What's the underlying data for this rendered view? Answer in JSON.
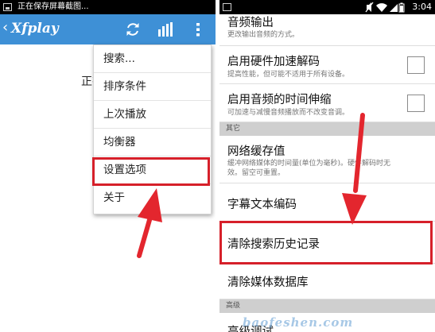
{
  "left_screen": {
    "status_text": "正在保存屏幕截图...",
    "app_title": "Xfplay",
    "background_text": "正在",
    "menu": [
      {
        "label": "搜索..."
      },
      {
        "label": "排序条件"
      },
      {
        "label": "上次播放"
      },
      {
        "label": "均衡器"
      },
      {
        "label": "设置选项",
        "highlighted": true
      },
      {
        "label": "关于"
      }
    ]
  },
  "right_screen": {
    "clock": "3:04",
    "prefs": [
      {
        "title": "音频输出",
        "summary": "更改输出音频的方式。"
      },
      {
        "title": "启用硬件加速解码",
        "summary": "提高性能，但可能不适用于所有设备。",
        "checked": false
      },
      {
        "title": "启用音频的时间伸缩",
        "summary": "可加速与减慢音频播放而不改变音调。",
        "checked": false
      }
    ],
    "category_other": "其它",
    "network_cache": {
      "title": "网络缓存值",
      "summary_line1": "缓冲网络媒体的时间量(单位为毫秒)。硬件解码时无",
      "summary_line2": "效。留空可重置。"
    },
    "subtitle_encoding": "字幕文本编码",
    "clear_history": {
      "title": "清除搜索历史记录",
      "highlighted": true
    },
    "clear_media_db": "清除媒体数据库",
    "category_advanced": "高级",
    "advanced_partial": "高级调试"
  },
  "watermark": "baofeshen.com",
  "colors": {
    "appbar": "#3e90d6",
    "highlight": "#d6202a",
    "arrow": "#e3262e",
    "category_bg": "#cfcfcf"
  },
  "icons": [
    "back-chevron-icon",
    "refresh-icon",
    "equalizer-bars-icon",
    "overflow-menu-icon",
    "screenshot-icon",
    "wifi-icon",
    "signal-icon",
    "battery-icon",
    "mute-icon",
    "checkbox-icon",
    "red-arrow-icon"
  ]
}
